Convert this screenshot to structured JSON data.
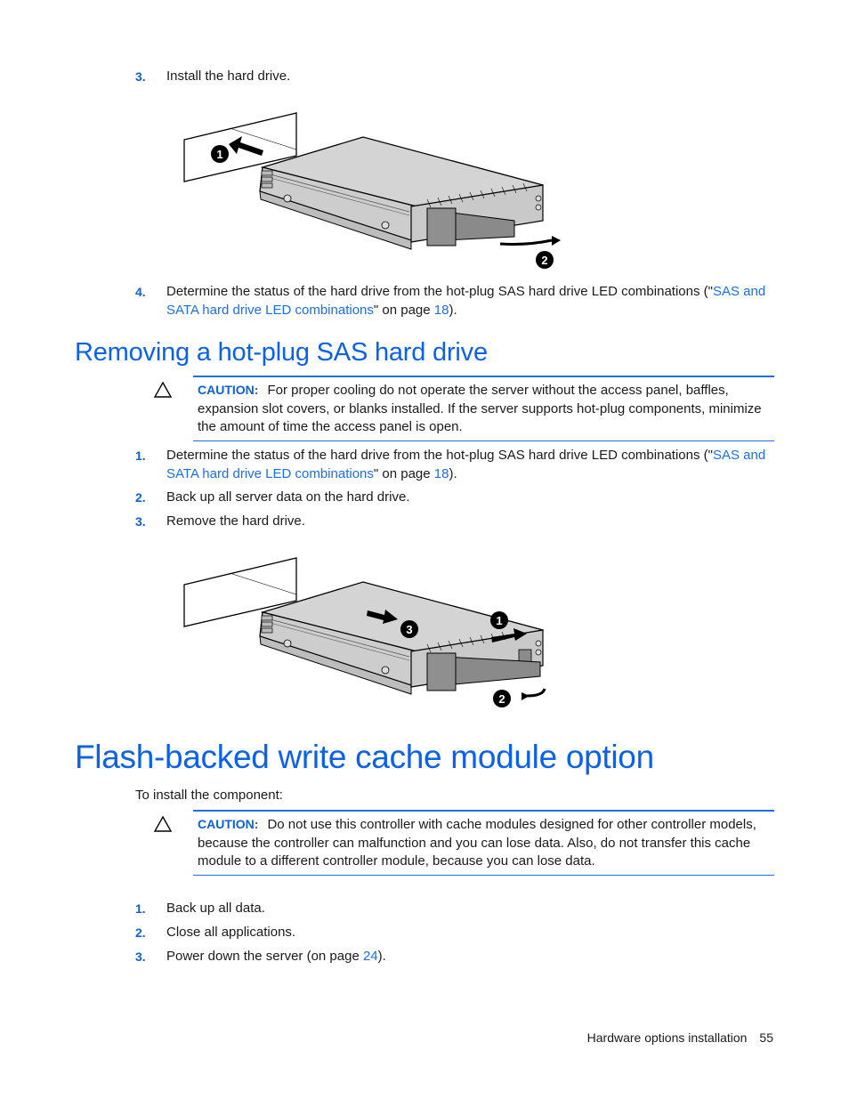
{
  "install_steps_tail": [
    {
      "num": "3.",
      "text": "Install the hard drive."
    },
    {
      "num": "4.",
      "pre": "Determine the status of the hard drive from the hot-plug SAS hard drive LED combinations (\"",
      "link": "SAS and SATA hard drive LED combinations",
      "mid": "\" on page ",
      "page_link": "18",
      "post": ")."
    }
  ],
  "figure_install": {
    "callouts": [
      "1",
      "2"
    ],
    "description": "Hard drive being inserted into bay (1) and latch lever closed (2)"
  },
  "section_remove": {
    "title": "Removing a hot-plug SAS hard drive",
    "caution": {
      "icon": "caution-triangle-icon",
      "label": "CAUTION:",
      "text": "For proper cooling do not operate the server without the access panel, baffles, expansion slot covers, or blanks installed. If the server supports hot-plug components, minimize the amount of time the access panel is open."
    },
    "steps": [
      {
        "num": "1.",
        "pre": "Determine the status of the hard drive from the hot-plug SAS hard drive LED combinations (\"",
        "link": "SAS and SATA hard drive LED combinations",
        "mid": "\" on page ",
        "page_link": "18",
        "post": ")."
      },
      {
        "num": "2.",
        "text": "Back up all server data on the hard drive."
      },
      {
        "num": "3.",
        "text": "Remove the hard drive."
      }
    ],
    "figure": {
      "callouts": [
        "1",
        "2",
        "3"
      ],
      "description": "Press release button (1), open lever (2), slide hard drive out (3)"
    }
  },
  "chapter_fbwc": {
    "title": "Flash-backed write cache module option",
    "intro": "To install the component:",
    "caution": {
      "icon": "caution-triangle-icon",
      "label": "CAUTION:",
      "text": "Do not use this controller with cache modules designed for other controller models, because the controller can malfunction and you can lose data. Also, do not transfer this cache module to a different controller module, because you can lose data."
    },
    "steps": [
      {
        "num": "1.",
        "text": "Back up all data."
      },
      {
        "num": "2.",
        "text": "Close all applications."
      },
      {
        "num": "3.",
        "pre": "Power down the server (on page ",
        "page_link": "24",
        "post": ")."
      }
    ]
  },
  "footer": {
    "section": "Hardware options installation",
    "page": "55"
  },
  "colors": {
    "accent": "#0b62e6",
    "link": "#1a6fe6",
    "text": "#1a1a1a",
    "drive_fill": "#d4d4d4",
    "handle_fill": "#8a8a8a"
  }
}
